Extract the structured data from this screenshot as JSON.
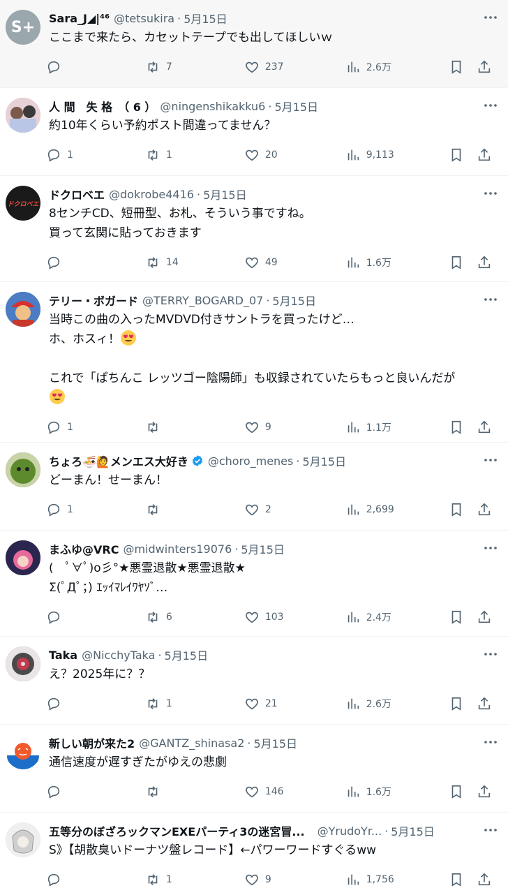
{
  "colors": {
    "text": "#0f1419",
    "secondary": "#536471",
    "divider": "#eff3f4",
    "verified": "#1d9bf0",
    "highlight": "#f7f7f7"
  },
  "tweets": [
    {
      "name": "Sara_J◢|⁴⁶",
      "handle": "@tetsukira",
      "sep": "·",
      "date": "5月15日",
      "text": "ここまで来たら、カセットテープでも出してほしいｗ",
      "replies": "",
      "retweets": "7",
      "likes": "237",
      "views": "2.6万",
      "avatar_text": "S+",
      "avatar_color": "#9aa7ad"
    },
    {
      "name": "人 間　失 格　（ 6 ）",
      "handle": "@ningenshikakku6",
      "sep": "·",
      "date": "5月15日",
      "text": "約10年くらい予約ポスト間違ってません？",
      "replies": "1",
      "retweets": "1",
      "likes": "20",
      "views": "9,113",
      "avatar_text": "",
      "avatar_color": "#c9a9b8"
    },
    {
      "name": "ドクロベエ",
      "handle": "@dokrobe4416",
      "sep": "·",
      "date": "5月15日",
      "text": "8センチCD、短冊型、お札、そういう事ですね。\n買って玄関に貼っておきます",
      "replies": "",
      "retweets": "14",
      "likes": "49",
      "views": "1.6万",
      "avatar_text": "ドクロベエ",
      "avatar_color": "#1a1a1a"
    },
    {
      "name": "テリー・ボガード",
      "handle": "@TERRY_BOGARD_07",
      "sep": "·",
      "date": "5月15日",
      "text_parts": [
        "当時この曲の入ったMVDVD付きサントラを買ったけど…\nホ、ホスィ！",
        "\n\nこれで「ぱちんこ レッツゴー陰陽師」も収録されていたらもっと良いんだが\n",
        ""
      ],
      "replies": "1",
      "retweets": "",
      "likes": "9",
      "views": "1.1万",
      "avatar_text": "",
      "avatar_color": "#3b6fb5"
    },
    {
      "name": "ちょろ🍜🙋メンエス大好き",
      "handle": "@choro_menes",
      "sep": "·",
      "date": "5月15日",
      "text": "どーまん！せーまん！",
      "replies": "1",
      "retweets": "",
      "likes": "2",
      "views": "2,699",
      "avatar_text": "",
      "avatar_color": "#6b8e3a"
    },
    {
      "name": "まふゆ@VRC",
      "handle": "@midwinters19076",
      "sep": "·",
      "date": "5月15日",
      "text": "(　ﾟ∀ﾟ)o彡°★悪霊退散★悪霊退散★\nΣ(ﾟДﾟ；) ｴｯｲﾏﾚｲﾜﾔｿﾞ…",
      "replies": "",
      "retweets": "6",
      "likes": "103",
      "views": "2.4万",
      "avatar_text": "",
      "avatar_color": "#c2557e"
    },
    {
      "name": "Taka",
      "handle": "@NicchyTaka",
      "sep": "·",
      "date": "5月15日",
      "text": "え？2025年に？？",
      "replies": "",
      "retweets": "1",
      "likes": "21",
      "views": "2.6万",
      "avatar_text": "",
      "avatar_color": "#8a7a80"
    },
    {
      "name": "新しい朝が来た2",
      "handle": "@GANTZ_shinasa2",
      "sep": "·",
      "date": "5月15日",
      "text": "通信速度が遅すぎたがゆえの悲劇",
      "replies": "",
      "retweets": "",
      "likes": "146",
      "views": "1.6万",
      "avatar_text": "",
      "avatar_color": "#ffffff"
    },
    {
      "name": "五等分のぼざろックマンEXEパーティ3の迷宮冒...",
      "handle": "@YrudoYr...",
      "sep": "·",
      "date": "5月15日",
      "text": "S》【胡散臭いドーナツ盤レコード】←パワーワードすぐるww",
      "replies": "",
      "retweets": "1",
      "likes": "9",
      "views": "1,756",
      "avatar_text": "",
      "avatar_color": "#d6d6d6"
    }
  ]
}
